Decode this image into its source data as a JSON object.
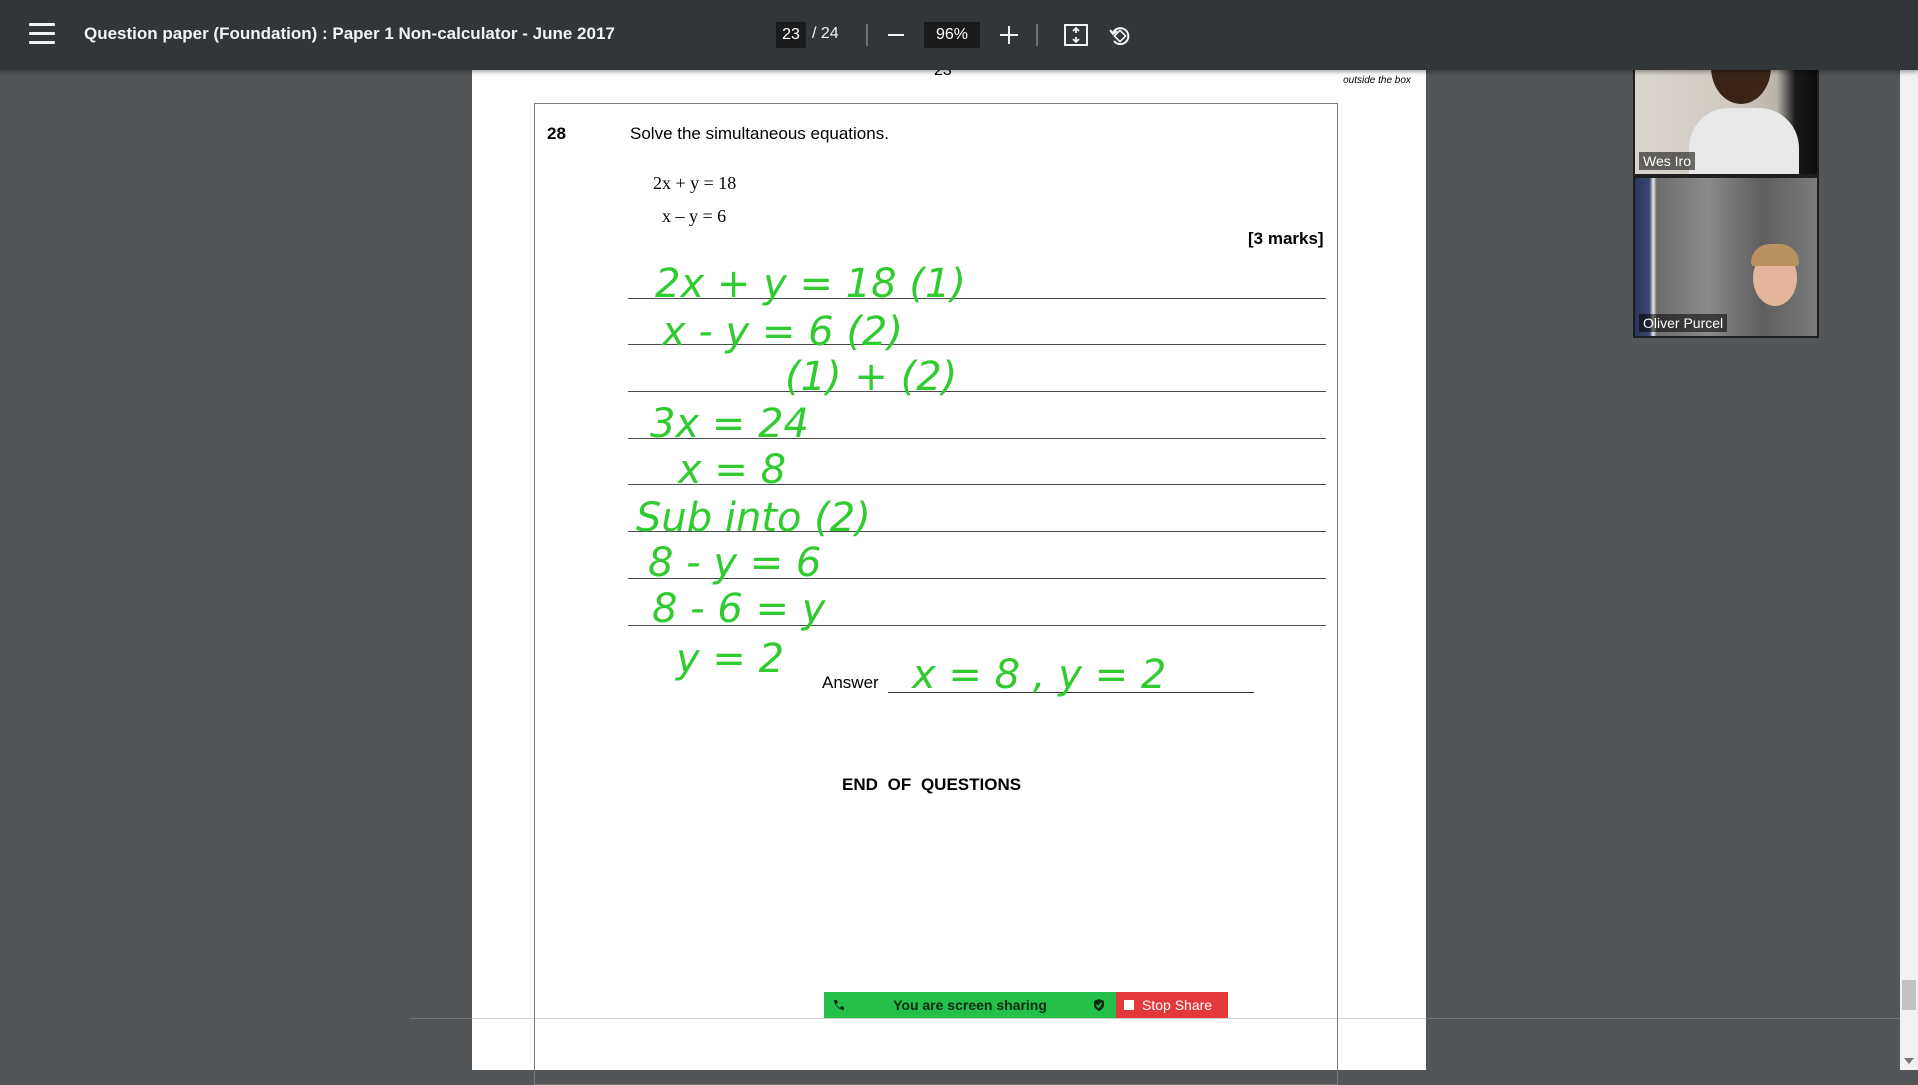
{
  "toolbar": {
    "title": "Question paper (Foundation) : Paper 1 Non-calculator - June 2017",
    "page_current": "23",
    "page_total": "/ 24",
    "zoom": "96%",
    "icons": [
      "menu-icon",
      "zoom-out-icon",
      "zoom-in-icon",
      "fit-page-icon",
      "rotate-icon"
    ]
  },
  "page": {
    "page_number": "23",
    "margin_note": "outside the box",
    "question_number": "28",
    "question_text": "Solve the simultaneous equations.",
    "equation_1": "2x + y = 18",
    "equation_2": "x – y = 6",
    "marks": "[3 marks]",
    "answer_label": "Answer",
    "end_text": "END OF QUESTIONS"
  },
  "handwriting": {
    "color": "#2fcb2f",
    "lines": [
      "2x + y = 18  (1)",
      "x - y = 6  (2)",
      "(1) + (2)",
      "3x = 24",
      "x = 8",
      "Sub into (2)",
      "8 - y = 6",
      "8 - 6 = y",
      "y = 2"
    ],
    "answer": "x = 8 , y = 2"
  },
  "participants": [
    {
      "name": "Wes Iro"
    },
    {
      "name": "Oliver Purcel"
    }
  ],
  "share_bar": {
    "status": "You are screen sharing",
    "stop_label": "Stop Share",
    "status_color": "#23c04a",
    "stop_color": "#e5383b"
  }
}
